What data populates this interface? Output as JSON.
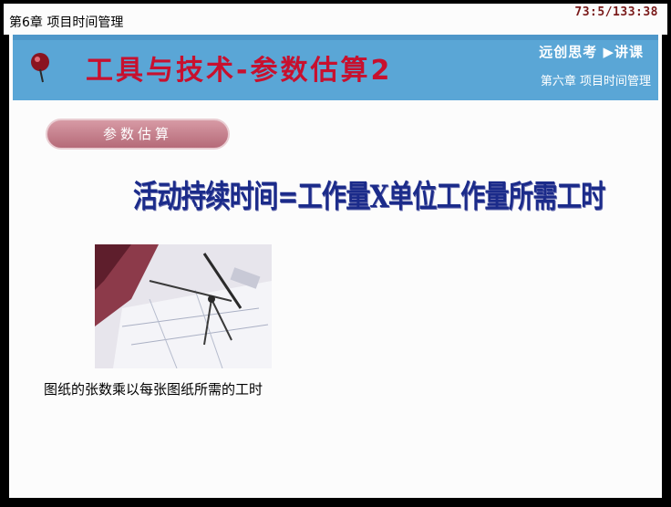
{
  "topbar": {
    "chapter": "第6章 项目时间管理",
    "timer": "73:5/133:38"
  },
  "banner": {
    "title": "工具与技术-参数估算2",
    "logo": "远创思考 ▶讲课",
    "subtitle": "第六章 项目时间管理"
  },
  "tag": {
    "label": "参数估算"
  },
  "formula": "活动持续时间=工作量X单位工作量所需工时",
  "caption": "图纸的张数乘以每张图纸所需的工时",
  "colors": {
    "banner": "#5aa6d6",
    "title": "#c8102e",
    "formula": "#1b2b8a",
    "pill": "#c47f8c"
  },
  "icons": {
    "pin": "pushpin-icon",
    "photo": "drafting-tools-photo"
  }
}
